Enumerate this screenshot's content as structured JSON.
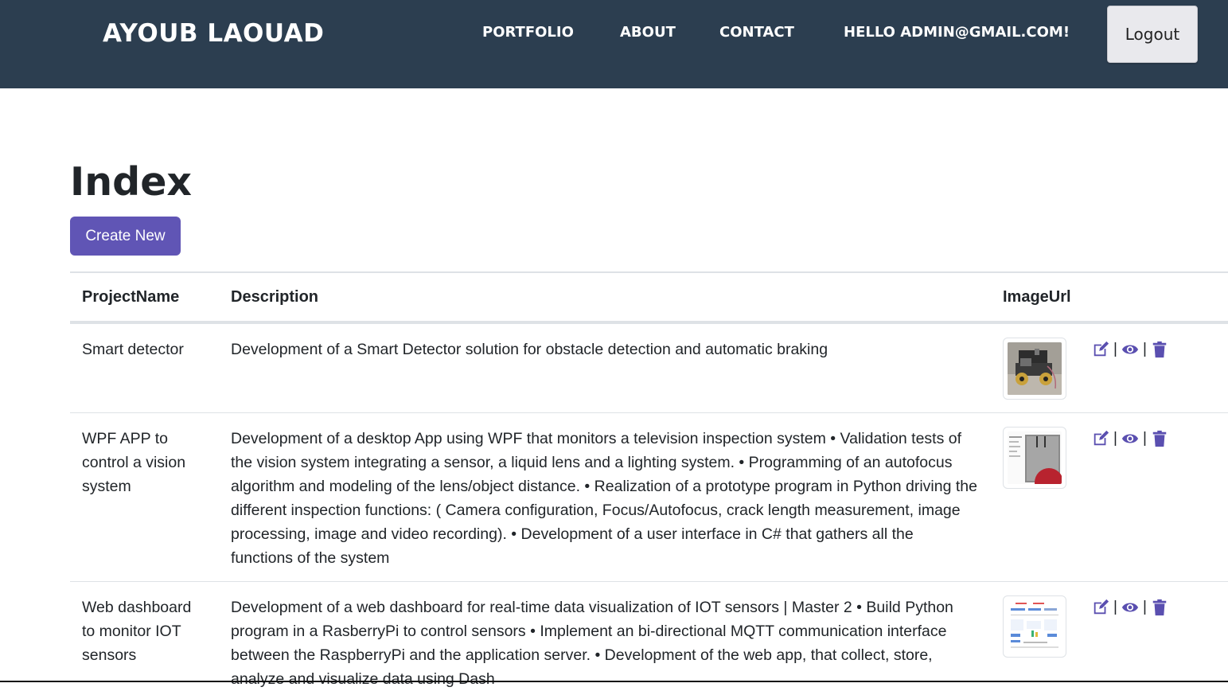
{
  "navbar": {
    "brand": "AYOUB LAOUAD",
    "links": [
      {
        "label": "PORTFOLIO"
      },
      {
        "label": "ABOUT"
      },
      {
        "label": "CONTACT"
      }
    ],
    "greeting": "HELLO ADMIN@GMAIL.COM!",
    "logout_label": "Logout"
  },
  "page": {
    "title": "Index",
    "create_label": "Create New"
  },
  "table": {
    "headers": {
      "project_name": "ProjectName",
      "description": "Description",
      "image_url": "ImageUrl"
    },
    "rows": [
      {
        "project_name": "Smart detector",
        "description": "Development of a Smart Detector solution for obstacle detection and automatic braking",
        "image": "robot-car-photo"
      },
      {
        "project_name": "WPF APP to control a vision system",
        "description": "Development of a desktop App using WPF that monitors a television inspection system • Validation tests of the vision system integrating a sensor, a liquid lens and a lighting system. • Programming of an autofocus algorithm and modeling of the lens/object distance. • Realization of a prototype program in Python driving the different inspection functions: ( Camera configuration, Focus/Autofocus, crack length measurement, image processing, image and video recording). • Development of a user interface in C# that gathers all the functions of the system",
        "image": "desktop-app-screenshot"
      },
      {
        "project_name": "Web dashboard to monitor IOT sensors",
        "description": "Development of a web dashboard for real-time data visualization of IOT sensors | Master 2 • Build Python program in a RasberryPi to control sensors • Implement an bi-directional MQTT communication interface between the RaspberryPi and the application server. • Development of the web app, that collect, store, analyze and visualize data using Dash",
        "image": "dashboard-screenshot"
      }
    ],
    "action_separator": "|",
    "action_icons": [
      "edit-icon",
      "eye-icon",
      "trash-icon"
    ]
  },
  "colors": {
    "navbar_bg": "#2c3e50",
    "primary": "#6055b5",
    "icon": "#5a4fb0"
  }
}
